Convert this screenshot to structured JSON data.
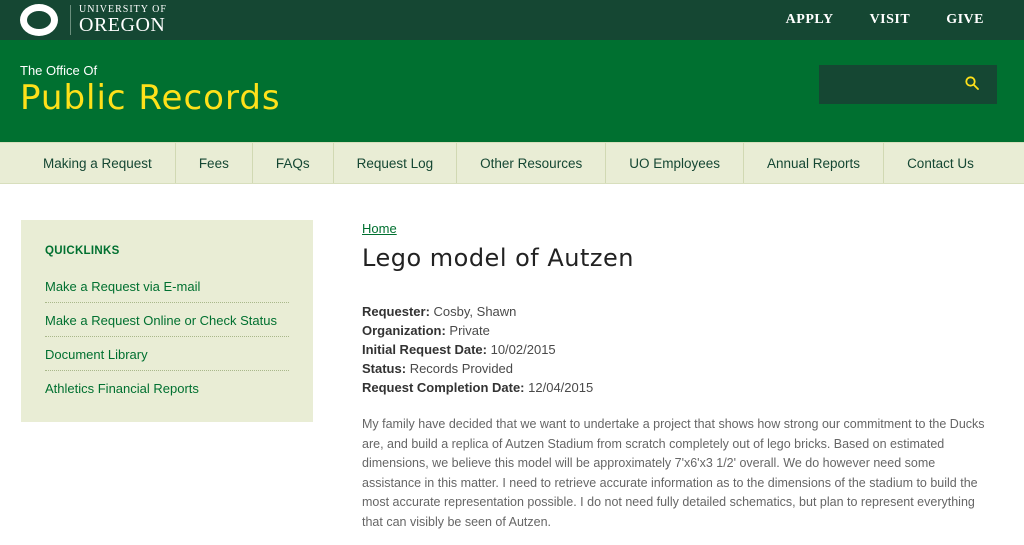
{
  "header": {
    "logo_small": "UNIVERSITY OF",
    "logo_big": "OREGON",
    "links": [
      "APPLY",
      "VISIT",
      "GIVE"
    ]
  },
  "banner": {
    "pre_title": "The Office Of",
    "title": "Public Records",
    "search_placeholder": ""
  },
  "nav": [
    "Making a Request",
    "Fees",
    "FAQs",
    "Request Log",
    "Other Resources",
    "UO Employees",
    "Annual Reports",
    "Contact Us"
  ],
  "quicklinks": {
    "heading": "QUICKLINKS",
    "items": [
      "Make a Request via E-mail",
      "Make a Request Online or Check Status",
      "Document Library",
      "Athletics Financial Reports"
    ]
  },
  "main": {
    "breadcrumb": "Home",
    "title": "Lego model of Autzen",
    "fields": [
      {
        "label": "Requester:",
        "value": "Cosby, Shawn"
      },
      {
        "label": "Organization:",
        "value": "Private"
      },
      {
        "label": "Initial Request Date:",
        "value": "10/02/2015"
      },
      {
        "label": "Status:",
        "value": "Records Provided"
      },
      {
        "label": "Request Completion Date:",
        "value": "12/04/2015"
      }
    ],
    "description": "My family have decided that we want to undertake a project that shows how strong our commitment to the Ducks are, and build a replica of Autzen Stadium from scratch completely out of lego bricks. Based on estimated dimensions, we believe this model will be approximately 7'x6'x3 1/2' overall. We do however need some assistance in this matter. I need to retrieve accurate information as to the dimensions of the stadium to build the most accurate representation possible. I do not need fully detailed schematics, but plan to represent everything that can visibly be seen of Autzen."
  },
  "colors": {
    "dark_green": "#154733",
    "green": "#007030",
    "yellow": "#fee11a",
    "light_green": "#e9edd5"
  }
}
